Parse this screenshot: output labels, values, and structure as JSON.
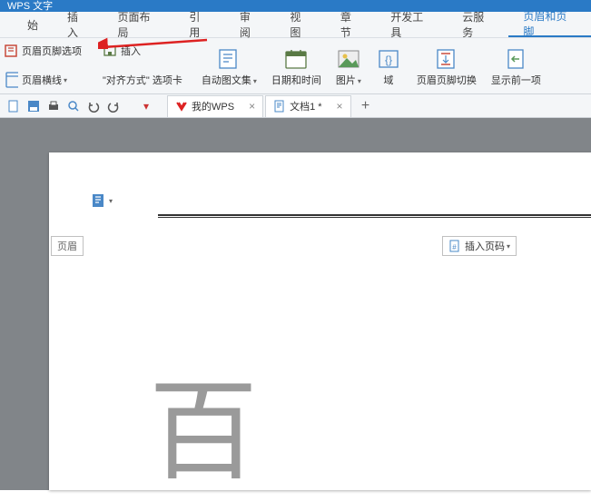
{
  "titlebar": {
    "app": "WPS 文字"
  },
  "menu": {
    "items": [
      "始",
      "插入",
      "页面布局",
      "引用",
      "审阅",
      "视图",
      "章节",
      "开发工具",
      "云服务",
      "页眉和页脚"
    ],
    "active_index": 9
  },
  "ribbon": {
    "left_rows": {
      "row1_label": "页眉页脚选项",
      "row2_label": "页眉横线"
    },
    "insert_group": {
      "row1_label": "插入",
      "row2_label": "\"对齐方式\" 选项卡"
    },
    "autotext": "自动图文集",
    "datetime": "日期和时间",
    "picture": "图片",
    "field": "域",
    "switch": "页眉页脚切换",
    "showprev": "显示前一项"
  },
  "tabs": {
    "home": "我的WPS",
    "doc1": "文档1 *",
    "add": "+"
  },
  "page": {
    "header_tag": "页眉",
    "insert_pagenum": "插入页码",
    "content_char": "百"
  }
}
